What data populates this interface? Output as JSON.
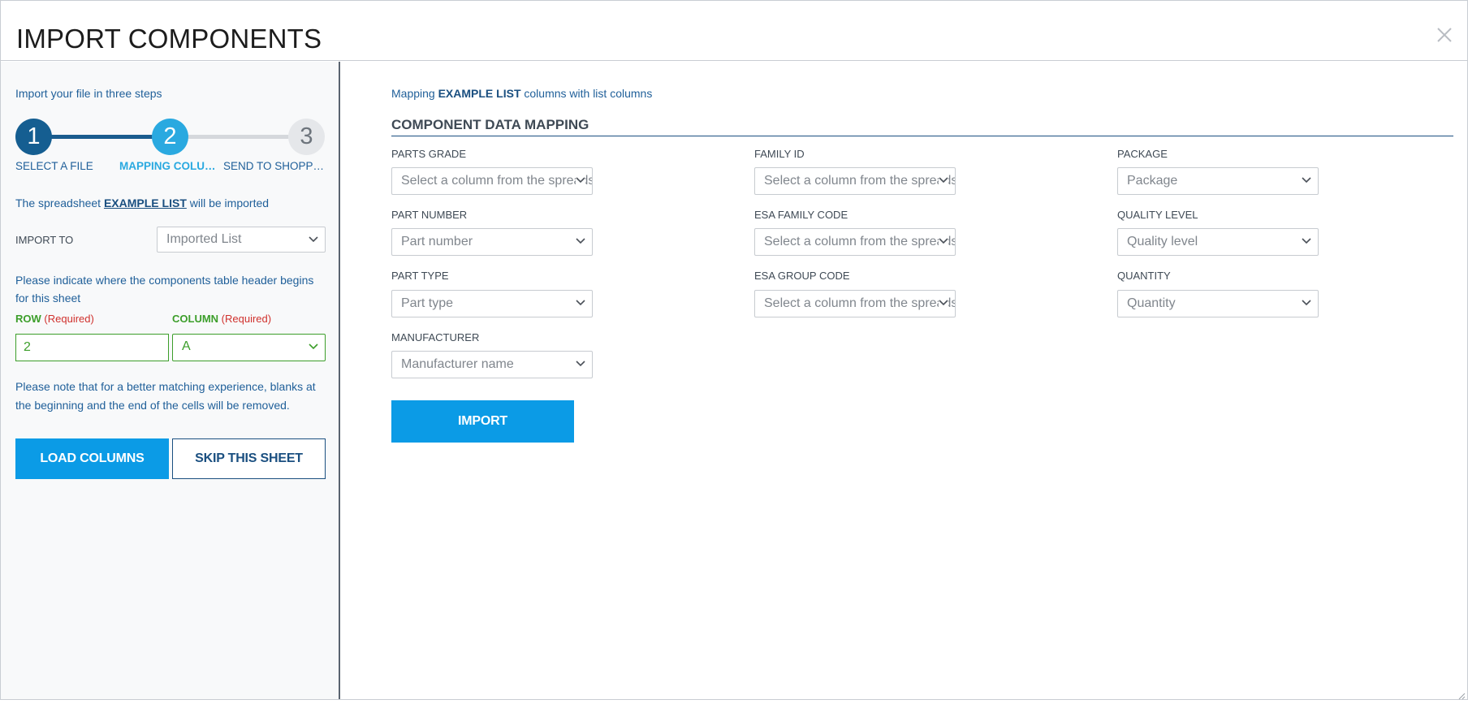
{
  "modal": {
    "title": "IMPORT COMPONENTS",
    "close_icon": "close-icon"
  },
  "sidebar": {
    "intro": "Import your file in three steps",
    "steps": [
      {
        "number": "1",
        "label": "SELECT A FILE",
        "state": "done"
      },
      {
        "number": "2",
        "label": "MAPPING COLUMNS",
        "state": "active"
      },
      {
        "number": "3",
        "label": "SEND TO SHOPPING CART",
        "state": "todo"
      }
    ],
    "spreadsheet_prefix": "The spreadsheet ",
    "spreadsheet_name": "EXAMPLE LIST",
    "spreadsheet_suffix": " will be imported",
    "import_to_label": "IMPORT TO",
    "import_to_value": "Imported List",
    "indicate_text": "Please indicate where the components table header begins for this sheet",
    "row_label": "ROW",
    "column_label": "COLUMN",
    "required_text": "(Required)",
    "row_value": "2",
    "column_value": "A",
    "note_text": "Please note that for a better matching experience, blanks at the beginning and the end of the cells will be removed.",
    "load_button": "LOAD COLUMNS",
    "skip_button": "SKIP THIS SHEET"
  },
  "main": {
    "intro_prefix": "Mapping ",
    "intro_name": "EXAMPLE LIST",
    "intro_suffix": " columns with list columns",
    "section_title": "COMPONENT DATA MAPPING",
    "fields": {
      "parts_grade": {
        "label": "PARTS GRADE",
        "value": "Select a column from the spreadsheet"
      },
      "part_number": {
        "label": "PART NUMBER",
        "value": "Part number"
      },
      "part_type": {
        "label": "PART TYPE",
        "value": "Part type"
      },
      "manufacturer": {
        "label": "MANUFACTURER",
        "value": "Manufacturer name"
      },
      "family_id": {
        "label": "FAMILY ID",
        "value": "Select a column from the spreadsheet"
      },
      "esa_family_code": {
        "label": "ESA FAMILY CODE",
        "value": "Select a column from the spreadsheet"
      },
      "esa_group_code": {
        "label": "ESA GROUP CODE",
        "value": "Select a column from the spreadsheet"
      },
      "package": {
        "label": "PACKAGE",
        "value": "Package"
      },
      "quality_level": {
        "label": "QUALITY LEVEL",
        "value": "Quality level"
      },
      "quantity": {
        "label": "QUANTITY",
        "value": "Quantity"
      }
    },
    "import_button": "IMPORT"
  },
  "colors": {
    "primary": "#0b9be6",
    "dark_blue": "#155e91",
    "active_step": "#2aa9e0",
    "success_green": "#3c9e2a",
    "required_red": "#d0312d"
  }
}
